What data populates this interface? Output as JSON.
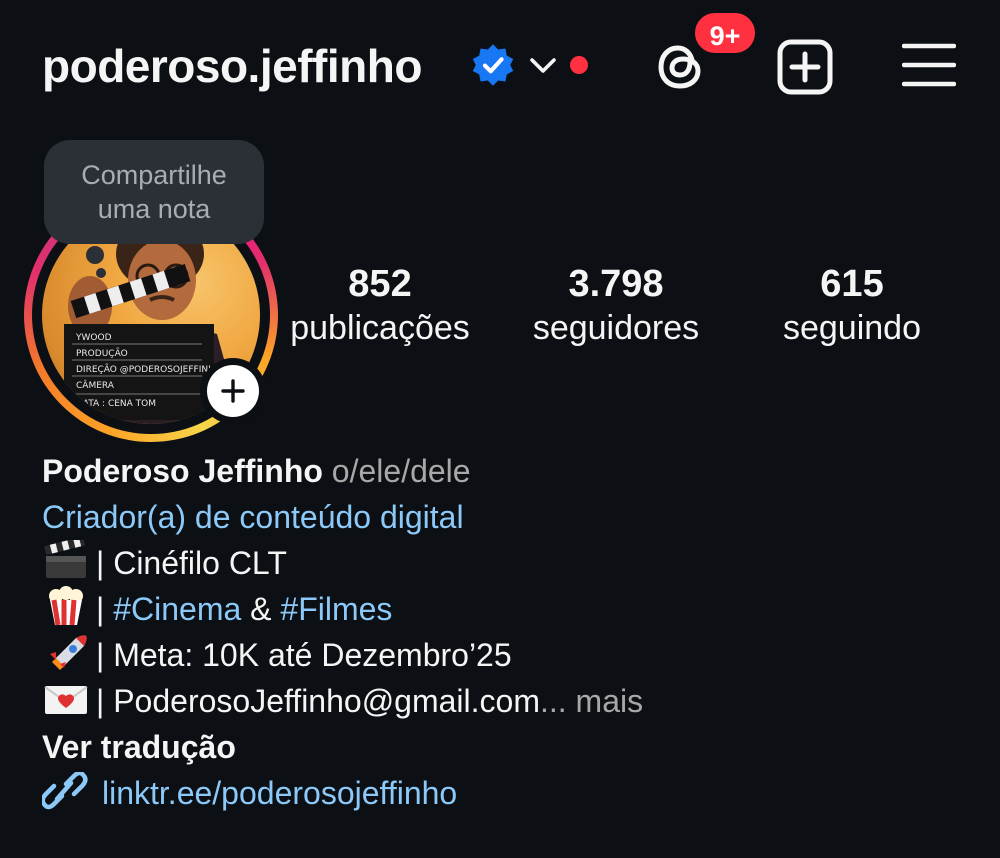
{
  "header": {
    "username": "poderoso.jeffinho",
    "verified_icon": "verified-badge-icon",
    "notification_badge": "9+",
    "colors": {
      "verified": "#1877f2",
      "badge": "#ff3040",
      "link": "#8cc9f9"
    }
  },
  "note": {
    "text_line1": "Compartilhe",
    "text_line2": "uma nota"
  },
  "stats": [
    {
      "value": "852",
      "label": "publicações"
    },
    {
      "value": "3.798",
      "label": "seguidores"
    },
    {
      "value": "615",
      "label": "seguindo"
    }
  ],
  "bio": {
    "name": "Poderoso Jeffinho",
    "pronouns": "o/ele/dele",
    "category": "Criador(a) de conteúdo digital",
    "line1_text": "| Cinéfilo CLT",
    "line2_sep": "|",
    "line2_tag1": "#Cinema",
    "line2_amp": "&",
    "line2_tag2": "#Filmes",
    "line3_text": "| Meta: 10K até Dezembro’25",
    "line4_text": "| PoderosoJeffinho@gmail.com",
    "line4_more": "... mais",
    "translate": "Ver tradução",
    "link": "linktr.ee/poderosojeffinho",
    "icons": [
      "clapperboard-emoji",
      "popcorn-emoji",
      "rocket-emoji",
      "love-letter-emoji",
      "link-icon"
    ]
  },
  "avatar": {
    "clapper_lines": [
      "YWOOD",
      "PRODUÇÃO",
      "DIREÇÃO @PODEROSOJEFFINHO",
      "CÂMERA",
      "DATA  : CENA    TOM"
    ]
  }
}
